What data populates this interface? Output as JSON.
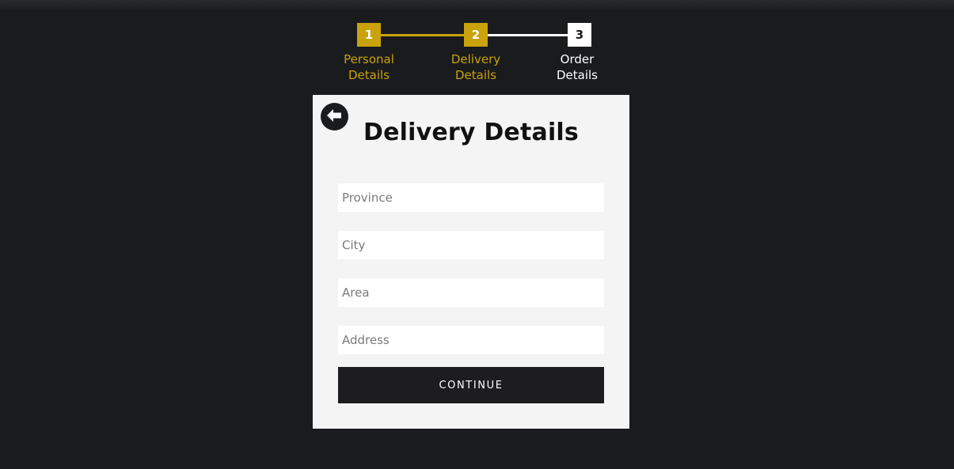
{
  "colors": {
    "background": "#1a1b1d",
    "accent": "#c9a20c",
    "card": "#f4f4f4",
    "inactive": "#ffffff"
  },
  "stepper": {
    "steps": [
      {
        "number": "1",
        "label_line1": "Personal",
        "label_line2": "Details",
        "state": "completed"
      },
      {
        "number": "2",
        "label_line1": "Delivery",
        "label_line2": "Details",
        "state": "active"
      },
      {
        "number": "3",
        "label_line1": "Order",
        "label_line2": "Details",
        "state": "pending"
      }
    ]
  },
  "form": {
    "back_icon": "arrow-left-circle-icon",
    "title": "Delivery Details",
    "fields": [
      {
        "name": "province",
        "placeholder": "Province",
        "value": ""
      },
      {
        "name": "city",
        "placeholder": "City",
        "value": ""
      },
      {
        "name": "area",
        "placeholder": "Area",
        "value": ""
      },
      {
        "name": "address",
        "placeholder": "Address",
        "value": ""
      }
    ],
    "continue_label": "CONTINUE"
  }
}
